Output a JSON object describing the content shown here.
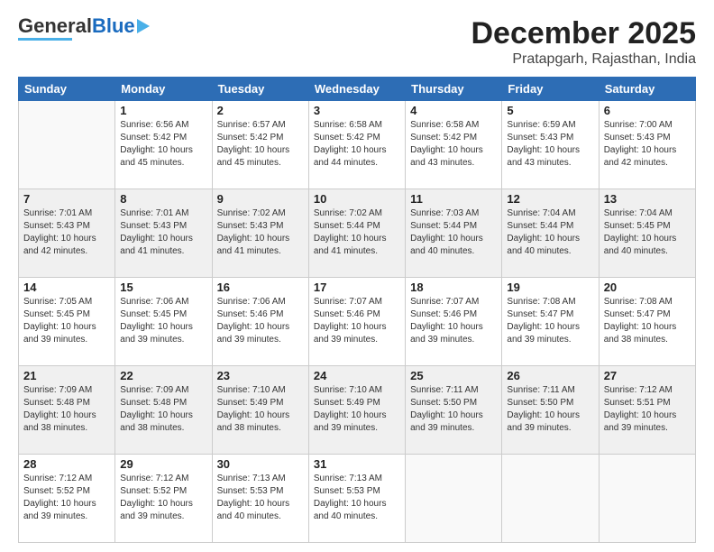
{
  "logo": {
    "general": "General",
    "blue": "Blue"
  },
  "header": {
    "month": "December 2025",
    "location": "Pratapgarh, Rajasthan, India"
  },
  "days_of_week": [
    "Sunday",
    "Monday",
    "Tuesday",
    "Wednesday",
    "Thursday",
    "Friday",
    "Saturday"
  ],
  "weeks": [
    [
      {
        "day": "",
        "info": ""
      },
      {
        "day": "1",
        "info": "Sunrise: 6:56 AM\nSunset: 5:42 PM\nDaylight: 10 hours\nand 45 minutes."
      },
      {
        "day": "2",
        "info": "Sunrise: 6:57 AM\nSunset: 5:42 PM\nDaylight: 10 hours\nand 45 minutes."
      },
      {
        "day": "3",
        "info": "Sunrise: 6:58 AM\nSunset: 5:42 PM\nDaylight: 10 hours\nand 44 minutes."
      },
      {
        "day": "4",
        "info": "Sunrise: 6:58 AM\nSunset: 5:42 PM\nDaylight: 10 hours\nand 43 minutes."
      },
      {
        "day": "5",
        "info": "Sunrise: 6:59 AM\nSunset: 5:43 PM\nDaylight: 10 hours\nand 43 minutes."
      },
      {
        "day": "6",
        "info": "Sunrise: 7:00 AM\nSunset: 5:43 PM\nDaylight: 10 hours\nand 42 minutes."
      }
    ],
    [
      {
        "day": "7",
        "info": "Sunrise: 7:01 AM\nSunset: 5:43 PM\nDaylight: 10 hours\nand 42 minutes."
      },
      {
        "day": "8",
        "info": "Sunrise: 7:01 AM\nSunset: 5:43 PM\nDaylight: 10 hours\nand 41 minutes."
      },
      {
        "day": "9",
        "info": "Sunrise: 7:02 AM\nSunset: 5:43 PM\nDaylight: 10 hours\nand 41 minutes."
      },
      {
        "day": "10",
        "info": "Sunrise: 7:02 AM\nSunset: 5:44 PM\nDaylight: 10 hours\nand 41 minutes."
      },
      {
        "day": "11",
        "info": "Sunrise: 7:03 AM\nSunset: 5:44 PM\nDaylight: 10 hours\nand 40 minutes."
      },
      {
        "day": "12",
        "info": "Sunrise: 7:04 AM\nSunset: 5:44 PM\nDaylight: 10 hours\nand 40 minutes."
      },
      {
        "day": "13",
        "info": "Sunrise: 7:04 AM\nSunset: 5:45 PM\nDaylight: 10 hours\nand 40 minutes."
      }
    ],
    [
      {
        "day": "14",
        "info": "Sunrise: 7:05 AM\nSunset: 5:45 PM\nDaylight: 10 hours\nand 39 minutes."
      },
      {
        "day": "15",
        "info": "Sunrise: 7:06 AM\nSunset: 5:45 PM\nDaylight: 10 hours\nand 39 minutes."
      },
      {
        "day": "16",
        "info": "Sunrise: 7:06 AM\nSunset: 5:46 PM\nDaylight: 10 hours\nand 39 minutes."
      },
      {
        "day": "17",
        "info": "Sunrise: 7:07 AM\nSunset: 5:46 PM\nDaylight: 10 hours\nand 39 minutes."
      },
      {
        "day": "18",
        "info": "Sunrise: 7:07 AM\nSunset: 5:46 PM\nDaylight: 10 hours\nand 39 minutes."
      },
      {
        "day": "19",
        "info": "Sunrise: 7:08 AM\nSunset: 5:47 PM\nDaylight: 10 hours\nand 39 minutes."
      },
      {
        "day": "20",
        "info": "Sunrise: 7:08 AM\nSunset: 5:47 PM\nDaylight: 10 hours\nand 38 minutes."
      }
    ],
    [
      {
        "day": "21",
        "info": "Sunrise: 7:09 AM\nSunset: 5:48 PM\nDaylight: 10 hours\nand 38 minutes."
      },
      {
        "day": "22",
        "info": "Sunrise: 7:09 AM\nSunset: 5:48 PM\nDaylight: 10 hours\nand 38 minutes."
      },
      {
        "day": "23",
        "info": "Sunrise: 7:10 AM\nSunset: 5:49 PM\nDaylight: 10 hours\nand 38 minutes."
      },
      {
        "day": "24",
        "info": "Sunrise: 7:10 AM\nSunset: 5:49 PM\nDaylight: 10 hours\nand 39 minutes."
      },
      {
        "day": "25",
        "info": "Sunrise: 7:11 AM\nSunset: 5:50 PM\nDaylight: 10 hours\nand 39 minutes."
      },
      {
        "day": "26",
        "info": "Sunrise: 7:11 AM\nSunset: 5:50 PM\nDaylight: 10 hours\nand 39 minutes."
      },
      {
        "day": "27",
        "info": "Sunrise: 7:12 AM\nSunset: 5:51 PM\nDaylight: 10 hours\nand 39 minutes."
      }
    ],
    [
      {
        "day": "28",
        "info": "Sunrise: 7:12 AM\nSunset: 5:52 PM\nDaylight: 10 hours\nand 39 minutes."
      },
      {
        "day": "29",
        "info": "Sunrise: 7:12 AM\nSunset: 5:52 PM\nDaylight: 10 hours\nand 39 minutes."
      },
      {
        "day": "30",
        "info": "Sunrise: 7:13 AM\nSunset: 5:53 PM\nDaylight: 10 hours\nand 40 minutes."
      },
      {
        "day": "31",
        "info": "Sunrise: 7:13 AM\nSunset: 5:53 PM\nDaylight: 10 hours\nand 40 minutes."
      },
      {
        "day": "",
        "info": ""
      },
      {
        "day": "",
        "info": ""
      },
      {
        "day": "",
        "info": ""
      }
    ]
  ]
}
